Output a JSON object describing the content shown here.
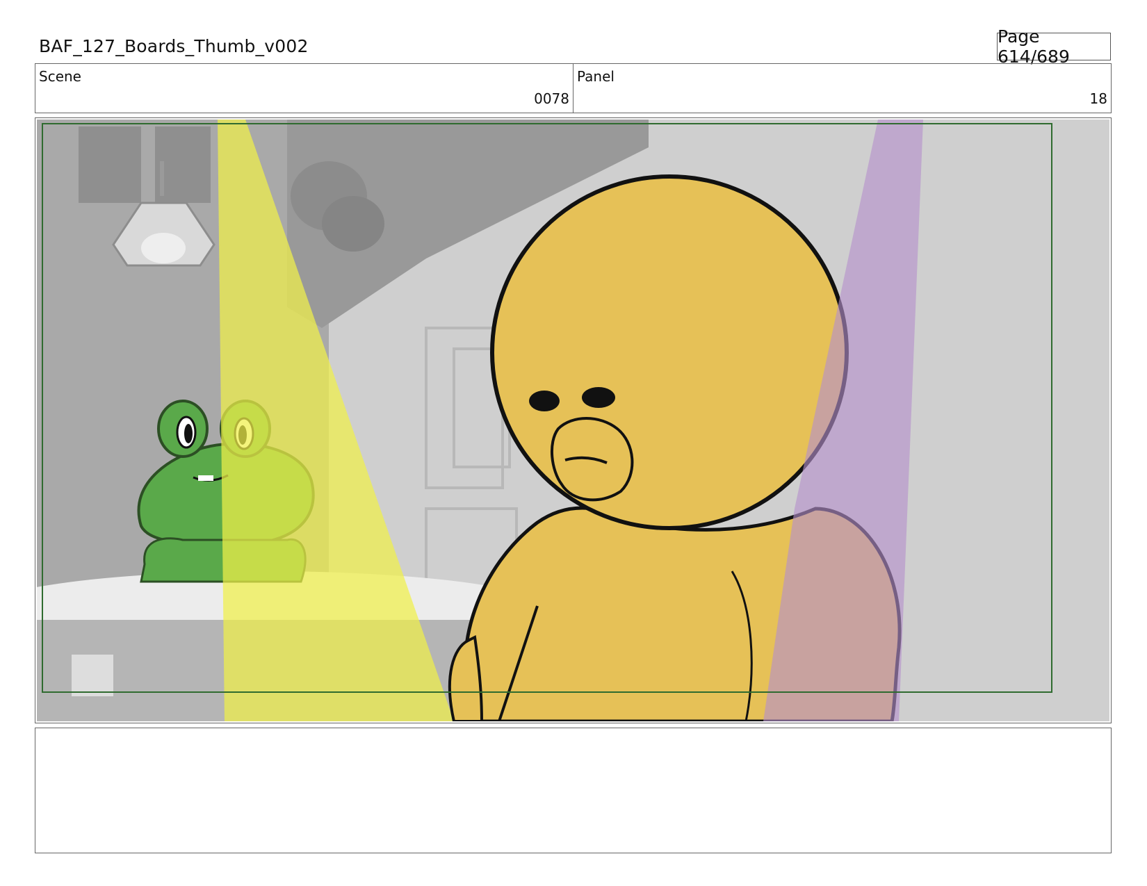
{
  "header": {
    "document_title": "BAF_127_Boards_Thumb_v002",
    "page_label": "Page 614/689"
  },
  "scene": {
    "label": "Scene",
    "value": "0078"
  },
  "panel": {
    "label": "Panel",
    "value": "18"
  },
  "notes": {
    "text": ""
  },
  "colors": {
    "safe_area_frame": "#2f6b2f",
    "character_duck": "#e6c157",
    "character_frog": "#5aa94a",
    "spotlight_yellow": "#f0f04a",
    "spotlight_purple": "#b490cc"
  }
}
